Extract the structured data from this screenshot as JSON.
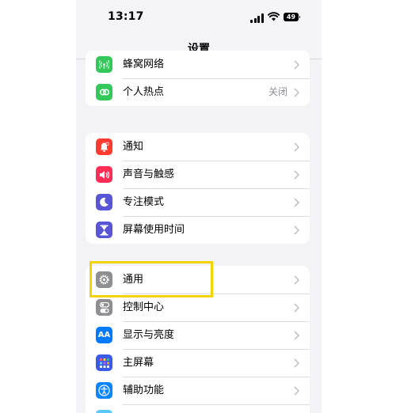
{
  "status_bar": {
    "time": "13:17",
    "battery": "49"
  },
  "nav": {
    "title": "设置"
  },
  "groups": [
    {
      "rows": [
        {
          "label": "蜂窝网络",
          "icon": "cellular-icon",
          "color": "#34c759"
        },
        {
          "label": "个人热点",
          "icon": "hotspot-icon",
          "color": "#34c759",
          "value": "关闭"
        }
      ]
    },
    {
      "rows": [
        {
          "label": "通知",
          "icon": "notification-bell-icon",
          "color": "#ff3b30"
        },
        {
          "label": "声音与触感",
          "icon": "speaker-icon",
          "color": "#ff2d55"
        },
        {
          "label": "专注模式",
          "icon": "moon-icon",
          "color": "#5856d6"
        },
        {
          "label": "屏幕使用时间",
          "icon": "hourglass-icon",
          "color": "#5856d6"
        }
      ]
    },
    {
      "rows": [
        {
          "label": "通用",
          "icon": "gear-icon",
          "color": "#8e8e93"
        },
        {
          "label": "控制中心",
          "icon": "toggles-icon",
          "color": "#8e8e93"
        },
        {
          "label": "显示与亮度",
          "icon": "text-size-icon",
          "color": "#007aff",
          "icon_text": "AA"
        },
        {
          "label": "主屏幕",
          "icon": "home-screen-grid-icon",
          "color": "#3c5ae8"
        },
        {
          "label": "辅助功能",
          "icon": "accessibility-icon",
          "color": "#0a84ff"
        }
      ]
    }
  ],
  "highlight": {
    "color": "#f3d400",
    "target": "通用"
  }
}
